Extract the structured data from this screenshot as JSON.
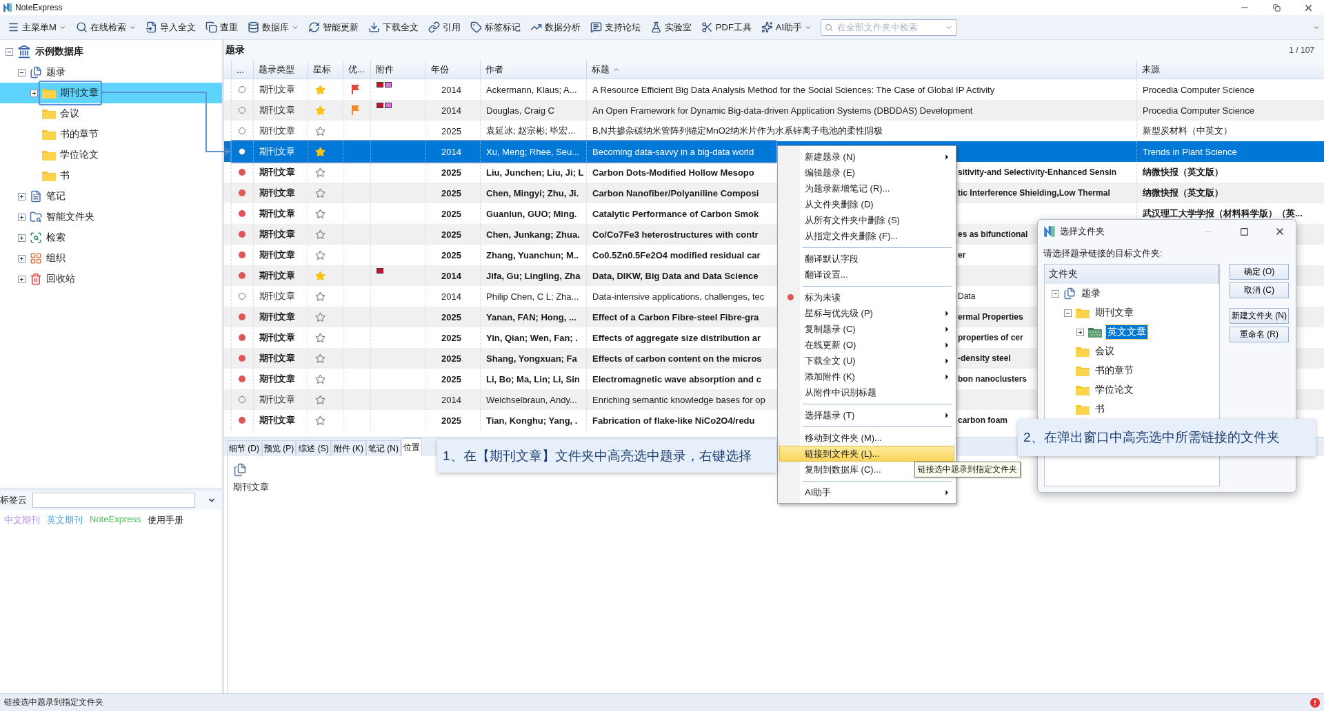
{
  "window": {
    "title": "NoteExpress"
  },
  "toolbar": {
    "items": [
      {
        "label": "主菜单M",
        "dropdown": true
      },
      {
        "label": "在线检索",
        "dropdown": true
      },
      {
        "label": "导入全文",
        "dropdown": false
      },
      {
        "label": "查重",
        "dropdown": false
      },
      {
        "label": "数据库",
        "dropdown": true
      },
      {
        "label": "智能更新",
        "dropdown": false
      },
      {
        "label": "下载全文",
        "dropdown": false
      },
      {
        "label": "引用",
        "dropdown": false
      },
      {
        "label": "标签标记",
        "dropdown": false
      },
      {
        "label": "数据分析",
        "dropdown": false
      },
      {
        "label": "支持论坛",
        "dropdown": false
      },
      {
        "label": "实验室",
        "dropdown": false
      },
      {
        "label": "PDF工具",
        "dropdown": false
      },
      {
        "label": "AI助手",
        "dropdown": true
      }
    ],
    "search": {
      "placeholder": "在全部文件夹中检索"
    }
  },
  "sidebar": {
    "tree": [
      {
        "label": "示例数据库",
        "kind": "database",
        "expanded": true,
        "selected": false,
        "children": [
          {
            "label": "题录",
            "kind": "records",
            "expanded": true,
            "selected": false,
            "children": [
              {
                "label": "期刊文章",
                "kind": "folder",
                "expanded": false,
                "selected": true
              },
              {
                "label": "会议",
                "kind": "folder",
                "selected": false
              },
              {
                "label": "书的章节",
                "kind": "folder",
                "selected": false
              },
              {
                "label": "学位论文",
                "kind": "folder",
                "selected": false
              },
              {
                "label": "书",
                "kind": "folder",
                "selected": false
              }
            ]
          },
          {
            "label": "笔记",
            "kind": "notes",
            "expanded": false,
            "selected": false
          },
          {
            "label": "智能文件夹",
            "kind": "smart",
            "expanded": false,
            "selected": false
          },
          {
            "label": "检索",
            "kind": "search",
            "expanded": false,
            "selected": false
          },
          {
            "label": "组织",
            "kind": "organize",
            "expanded": false,
            "selected": false
          },
          {
            "label": "回收站",
            "kind": "trash",
            "expanded": false,
            "selected": false
          }
        ]
      }
    ],
    "tag_cloud": {
      "label": "标签云",
      "tags": [
        {
          "label": "中文期刊",
          "color": "#b38cf0"
        },
        {
          "label": "英文期刊",
          "color": "#4aa3e8"
        },
        {
          "label": "NoteExpress",
          "color": "#4cc45a"
        },
        {
          "label": "使用手册",
          "color": "#222222"
        }
      ]
    }
  },
  "table": {
    "title": "题录",
    "page": "1 / 107",
    "columns": [
      {
        "label": "...",
        "sorted": false
      },
      {
        "label": "题录类型",
        "sorted": false
      },
      {
        "label": "星标",
        "sorted": false
      },
      {
        "label": "优...",
        "sorted": false
      },
      {
        "label": "附件",
        "sorted": false
      },
      {
        "label": "年份",
        "sorted": false
      },
      {
        "label": "作者",
        "sorted": false
      },
      {
        "label": "标题",
        "sorted": true
      },
      {
        "label": "来源",
        "sorted": false
      }
    ],
    "rows": [
      {
        "unread": false,
        "selected": false,
        "type": "期刊文章",
        "starred": true,
        "flag": {
          "color": "#e04a3a"
        },
        "attachments": [
          {
            "color": "#d01020"
          },
          {
            "color": "#e070d8"
          }
        ],
        "year": "2014",
        "author": "Ackermann, Klaus; A...",
        "title": "A Resource Efficient Big Data Analysis Method for the Social Sciences: The Case of Global IP Activity",
        "source": "Procedia Computer Science"
      },
      {
        "unread": false,
        "selected": false,
        "type": "期刊文章",
        "starred": true,
        "flag": {
          "color": "#f08a30"
        },
        "attachments": [
          {
            "color": "#d01020"
          },
          {
            "color": "#e070d8"
          }
        ],
        "year": "2014",
        "author": "Douglas, Craig C",
        "title": "An Open Framework for Dynamic Big-data-driven Application Systems (DBDDAS) Development",
        "source": "Procedia Computer Science"
      },
      {
        "unread": false,
        "selected": false,
        "type": "期刊文章",
        "starred": false,
        "attachments": [],
        "year": "2025",
        "author": "袁延冰; 赵宗彬; 毕宏...",
        "title": "B,N共掺杂碳纳米管阵列锚定MnO2纳米片作为水系锌离子电池的柔性阴极",
        "source": "新型炭材料（中英文）"
      },
      {
        "unread": false,
        "selected": true,
        "type": "期刊文章",
        "starred": true,
        "attachments": [],
        "year": "2014",
        "author": "Xu, Meng; Rhee, Seu...",
        "title": "Becoming data-savvy in a big-data world",
        "source": "Trends in Plant Science"
      },
      {
        "unread": true,
        "selected": false,
        "type": "期刊文章",
        "starred": false,
        "attachments": [],
        "year": "2025",
        "author": "Liu, Junchen; Liu, Ji; L",
        "title": "Carbon Dots-Modified Hollow Mesopo",
        "title_tail": "sitivity-and Selectivity-Enhanced Sensin",
        "source": "纳微快报（英文版）"
      },
      {
        "unread": true,
        "selected": false,
        "type": "期刊文章",
        "starred": false,
        "attachments": [],
        "year": "2025",
        "author": "Chen, Mingyi; Zhu, Ji.",
        "title": "Carbon Nanofiber/Polyaniline Composi",
        "title_tail": "tic Interference Shielding,Low Thermal",
        "source": "纳微快报（英文版）"
      },
      {
        "unread": true,
        "selected": false,
        "type": "期刊文章",
        "starred": false,
        "attachments": [],
        "year": "2025",
        "author": "Guanlun, GUO; Ming.",
        "title": "Catalytic Performance of Carbon Smok",
        "source": "武汉理工大学学报（材料科学版）（英..."
      },
      {
        "unread": true,
        "selected": false,
        "type": "期刊文章",
        "starred": false,
        "attachments": [],
        "year": "2025",
        "author": "Chen, Junkang; Zhua.",
        "title": "Co/Co7Fe3 heterostructures with contr",
        "title_tail": "es as bifunctional"
      },
      {
        "unread": true,
        "selected": false,
        "type": "期刊文章",
        "starred": false,
        "attachments": [],
        "year": "2025",
        "author": "Zhang, Yuanchun; M..",
        "title": "Co0.5Zn0.5Fe2O4 modified residual car",
        "title_tail": "er"
      },
      {
        "unread": true,
        "selected": false,
        "type": "期刊文章",
        "starred": true,
        "attachments": [
          {
            "color": "#d01020"
          }
        ],
        "year": "2014",
        "author": "Jifa, Gu; Lingling, Zha",
        "title": "Data, DIKW, Big Data and Data Science"
      },
      {
        "unread": false,
        "selected": false,
        "type": "期刊文章",
        "starred": false,
        "attachments": [],
        "year": "2014",
        "author": "Philip Chen, C L; Zha...",
        "title": "Data-intensive applications, challenges, tec",
        "title_tail": "Data"
      },
      {
        "unread": true,
        "selected": false,
        "type": "期刊文章",
        "starred": false,
        "attachments": [],
        "year": "2025",
        "author": "Yanan, FAN; Hong, ...",
        "title": "Effect of a Carbon Fibre-steel Fibre-gra",
        "title_tail": "ermal Properties"
      },
      {
        "unread": true,
        "selected": false,
        "type": "期刊文章",
        "starred": false,
        "attachments": [],
        "year": "2025",
        "author": "Yin, Qian; Wen, Fan; .",
        "title": "Effects of aggregate size distribution ar",
        "title_tail": "properties of cer"
      },
      {
        "unread": true,
        "selected": false,
        "type": "期刊文章",
        "starred": false,
        "attachments": [],
        "year": "2025",
        "author": "Shang, Yongxuan; Fa",
        "title": "Effects of carbon content on the micros",
        "title_tail": "-density steel"
      },
      {
        "unread": true,
        "selected": false,
        "type": "期刊文章",
        "starred": false,
        "attachments": [],
        "year": "2025",
        "author": "Li, Bo; Ma, Lin; Li, Sin",
        "title": "Electromagnetic wave absorption and c",
        "title_tail": "bon nanoclusters"
      },
      {
        "unread": false,
        "selected": false,
        "type": "期刊文章",
        "starred": false,
        "attachments": [],
        "year": "2014",
        "author": "Weichselbraun, Andy...",
        "title": "Enriching semantic knowledge bases for op"
      },
      {
        "unread": true,
        "selected": false,
        "type": "期刊文章",
        "starred": false,
        "attachments": [],
        "year": "2025",
        "author": "Tian, Konghu; Yang, .",
        "title": "Fabrication of flake-like NiCo2O4/redu",
        "title_tail": "carbon foam"
      }
    ]
  },
  "detail_tabs": [
    {
      "label": "细节 (D)",
      "selected": false
    },
    {
      "label": "预览 (P)",
      "selected": false
    },
    {
      "label": "综述 (S)",
      "selected": false
    },
    {
      "label": "附件 (K)",
      "selected": false
    },
    {
      "label": "笔记 (N)",
      "selected": false
    },
    {
      "label": "位置",
      "selected": true
    }
  ],
  "preview": {
    "label": "期刊文章"
  },
  "context_menu": {
    "items": [
      {
        "kind": "item",
        "label": "新建题录 (N)",
        "submenu": true,
        "selected": false,
        "bullet": false
      },
      {
        "kind": "item",
        "label": "编辑题录 (E)",
        "submenu": false,
        "selected": false,
        "bullet": false
      },
      {
        "kind": "item",
        "label": "为题录新增笔记 (R)...",
        "submenu": false,
        "selected": false,
        "bullet": false
      },
      {
        "kind": "item",
        "label": "从文件夹删除 (D)",
        "submenu": false,
        "selected": false,
        "bullet": false
      },
      {
        "kind": "item",
        "label": "从所有文件夹中删除 (S)",
        "submenu": false,
        "selected": false,
        "bullet": false
      },
      {
        "kind": "item",
        "label": "从指定文件夹删除 (F)...",
        "submenu": false,
        "selected": false,
        "bullet": false
      },
      {
        "kind": "separator"
      },
      {
        "kind": "item",
        "label": "翻译默认字段",
        "submenu": false,
        "selected": false,
        "bullet": false
      },
      {
        "kind": "item",
        "label": "翻译设置...",
        "submenu": false,
        "selected": false,
        "bullet": false
      },
      {
        "kind": "separator"
      },
      {
        "kind": "item",
        "label": "标为未读",
        "submenu": false,
        "selected": false,
        "bullet": true
      },
      {
        "kind": "item",
        "label": "星标与优先级 (P)",
        "submenu": true,
        "selected": false,
        "bullet": false
      },
      {
        "kind": "item",
        "label": "复制题录 (C)",
        "submenu": true,
        "selected": false,
        "bullet": false
      },
      {
        "kind": "item",
        "label": "在线更新 (O)",
        "submenu": true,
        "selected": false,
        "bullet": false
      },
      {
        "kind": "item",
        "label": "下载全文 (U)",
        "submenu": true,
        "selected": false,
        "bullet": false
      },
      {
        "kind": "item",
        "label": "添加附件 (K)",
        "submenu": true,
        "selected": false,
        "bullet": false
      },
      {
        "kind": "item",
        "label": "从附件中识别标题",
        "submenu": false,
        "selected": false,
        "bullet": false
      },
      {
        "kind": "separator"
      },
      {
        "kind": "item",
        "label": "选择题录 (T)",
        "submenu": true,
        "selected": false,
        "bullet": false
      },
      {
        "kind": "separator"
      },
      {
        "kind": "item",
        "label": "移动到文件夹 (M)...",
        "submenu": false,
        "selected": false,
        "bullet": false
      },
      {
        "kind": "item",
        "label": "链接到文件夹 (L)...",
        "submenu": false,
        "selected": true,
        "bullet": false
      },
      {
        "kind": "item",
        "label": "复制到数据库 (C)...",
        "submenu": false,
        "selected": false,
        "bullet": false
      },
      {
        "kind": "separator"
      },
      {
        "kind": "item",
        "label": "AI助手",
        "submenu": true,
        "selected": false,
        "bullet": false
      }
    ]
  },
  "tooltip": "链接选中题录到指定文件夹",
  "dialog": {
    "title": "选择文件夹",
    "prompt": "请选择题录链接的目标文件夹:",
    "tree_header": "文件夹",
    "tree": [
      {
        "label": "题录",
        "kind": "records",
        "expanded": true,
        "selected": false,
        "children": [
          {
            "label": "期刊文章",
            "kind": "folder",
            "expanded": true,
            "selected": false,
            "children": [
              {
                "label": "英文文章",
                "kind": "checkered",
                "expanded": false,
                "selected": true
              }
            ]
          },
          {
            "label": "会议",
            "kind": "folder",
            "selected": false
          },
          {
            "label": "书的章节",
            "kind": "folder",
            "selected": false
          },
          {
            "label": "学位论文",
            "kind": "folder",
            "selected": false
          },
          {
            "label": "书",
            "kind": "folder",
            "selected": false
          }
        ]
      }
    ],
    "buttons": [
      "确定 (O)",
      "取消 (C)",
      "新建文件夹 (N)",
      "重命名 (R)"
    ]
  },
  "callouts": [
    "1、在【期刊文章】文件夹中高亮选中题录，右键选择",
    "2、在弹出窗口中高亮选中所需链接的文件夹"
  ],
  "status_bar": "链接选中题录到指定文件夹"
}
